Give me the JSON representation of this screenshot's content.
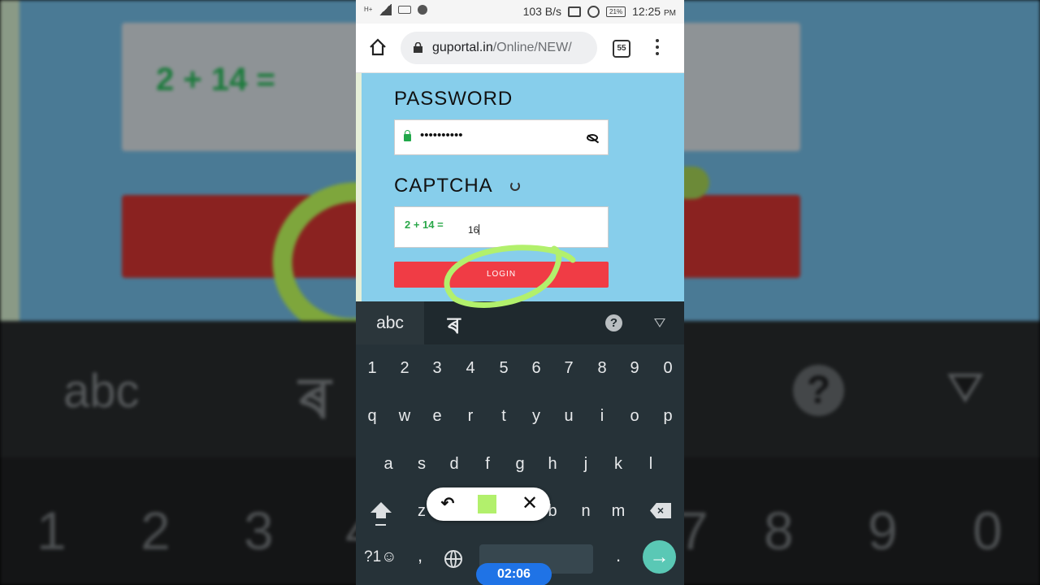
{
  "status": {
    "network_type": "H+",
    "net_speed": "103 B/s",
    "battery": "21%",
    "time": "12:25",
    "ampm": "PM"
  },
  "browser": {
    "url_domain": "guportal.in",
    "url_path": "/Online/NEW/",
    "tab_count": "55"
  },
  "page": {
    "password_label": "PASSWORD",
    "password_value": "••••••••••",
    "captcha_label": "CAPTCHA",
    "captcha_question": "2 + 14 =",
    "captcha_value": "16",
    "login_label": "LOGIN",
    "accent_color": "#f03c45",
    "bg_color": "#87ceeb"
  },
  "keyboard": {
    "lang_tabs": [
      "abc",
      "ৰ"
    ],
    "help": "?",
    "number_row": [
      "1",
      "2",
      "3",
      "4",
      "5",
      "6",
      "7",
      "8",
      "9",
      "0"
    ],
    "row1": [
      "q",
      "w",
      "e",
      "r",
      "t",
      "y",
      "u",
      "i",
      "o",
      "p"
    ],
    "row2": [
      "a",
      "s",
      "d",
      "f",
      "g",
      "h",
      "j",
      "k",
      "l"
    ],
    "row3": [
      "z",
      "b",
      "n",
      "m"
    ],
    "symbols_key": "?1☺",
    "comma": ",",
    "period": ".",
    "go_icon": "→"
  },
  "overlay": {
    "undo_icon": "undo-icon",
    "close_icon": "close-icon",
    "ink_color": "#b2f06c",
    "timer": "02:06"
  },
  "background_echo": {
    "captcha_question": "2 + 14 =",
    "abc": "abc",
    "bengali": "ৰ",
    "help": "?",
    "numbers": [
      "1",
      "2",
      "3",
      "4",
      "7",
      "8",
      "9",
      "0"
    ]
  }
}
